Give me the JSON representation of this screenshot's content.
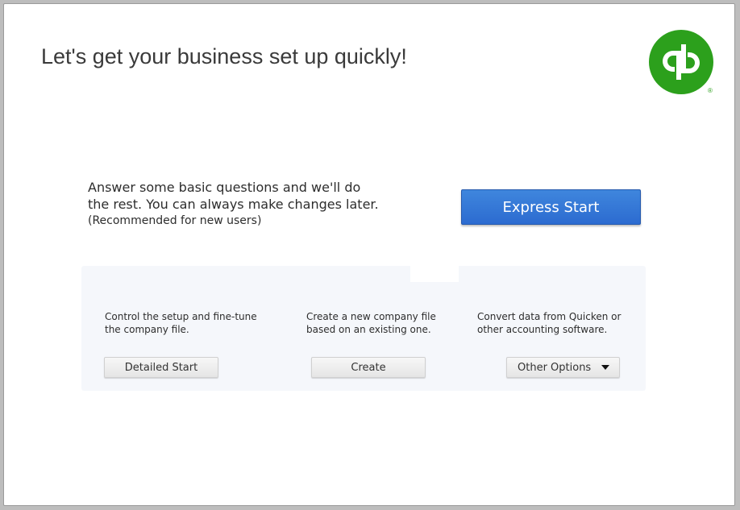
{
  "header": {
    "headline": "Let's get your business set up quickly!",
    "logo_icon": "quickbooks-logo-icon",
    "logo_registered": "®",
    "brand_color": "#2ca01c"
  },
  "express": {
    "line1": "Answer some basic questions and we'll do",
    "line2": "the rest. You can always make changes later.",
    "note": "(Recommended for new users)",
    "button_label": "Express Start",
    "button_color": "#3278d8"
  },
  "options": {
    "detailed": {
      "description": "Control the setup and fine-tune the company file.",
      "button_label": "Detailed Start"
    },
    "create": {
      "description": "Create a new company file based on an existing one.",
      "button_label": "Create"
    },
    "other": {
      "description": "Convert data from Quicken or other accounting software.",
      "button_label": "Other Options",
      "dropdown_icon": "caret-down-icon"
    }
  }
}
